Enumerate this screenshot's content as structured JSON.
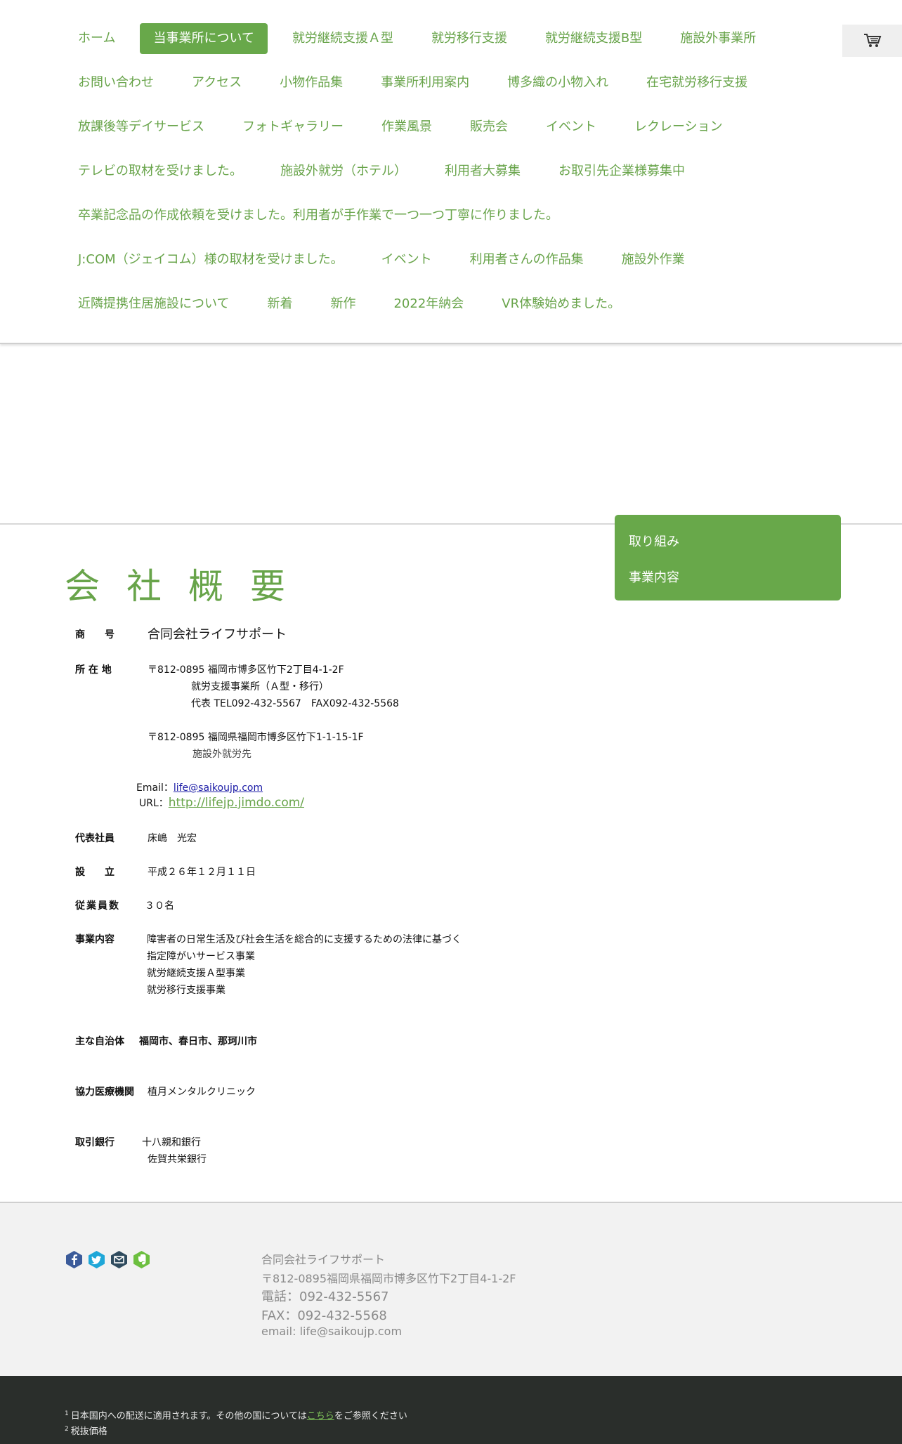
{
  "nav": {
    "rows": [
      [
        "ホーム",
        "当事業所について",
        "就労継続支援Ａ型",
        "就労移行支援",
        "就労継続支援B型",
        "施設外事業所"
      ],
      [
        "お問い合わせ",
        "アクセス",
        "小物作品集",
        "事業所利用案内",
        "博多織の小物入れ",
        "在宅就労移行支援"
      ],
      [
        "放課後等デイサービス",
        "フォトギャラリー",
        "作業風景",
        "販売会",
        "イベント",
        "レクレーション"
      ],
      [
        "テレビの取材を受けました。",
        "施設外就労（ホテル）",
        "利用者大募集",
        "お取引先企業様募集中"
      ],
      [
        "卒業記念品の作成依頼を受けました。利用者が手作業で一つ一つ丁寧に作りました。"
      ],
      [
        "J:COM（ジェイコム）様の取材を受けました。",
        "イベント",
        "利用者さんの作品集",
        "施設外作業"
      ],
      [
        "近隣提携住居施設について",
        "新着",
        "新作",
        "2022年納会",
        "VR体験始めました。"
      ]
    ],
    "active": "当事業所について",
    "cart_icon": "cart-icon"
  },
  "submenu": {
    "items": [
      "取り組み",
      "事業内容"
    ]
  },
  "company": {
    "title": "会社概要",
    "name_label": "商　　号",
    "name_value": "合同会社ライフサポート",
    "address_label": "所 在 地",
    "address_lines": [
      "〒812-0895 福岡市博多区竹下2丁目4-1-2F",
      "就労支援事業所（Ａ型・移行）",
      "代表 TEL092-432-5567　FAX092-432-5568"
    ],
    "address2_lines": [
      "〒812-0895 福岡県福岡市博多区竹下1-1-15-1F",
      "施設外就労先"
    ],
    "email_label": "Email：",
    "email": "life@saikoujp.com",
    "url_label": "URL：",
    "url": "http://lifejp.jimdo.com/",
    "rep_label": "代表社員",
    "rep_value": "床嶋　光宏",
    "est_label": "設　　立",
    "est_value": "平成２６年１２月１１日",
    "emp_label": "従業員数",
    "emp_value": "３０名",
    "biz_label": "事業内容",
    "biz_lines": [
      "障害者の日常生活及び社会生活を総合的に支援するための法律に基づく",
      "指定障がいサービス事業",
      "就労継続支援Ａ型事業",
      "就労移行支援事業"
    ],
    "muni_label": "主な自治体",
    "muni_value": "福岡市、春日市、那珂川市",
    "med_label": "協力医療機関",
    "med_value": "植月メンタルクリニック",
    "bank_label": "取引銀行",
    "bank_lines": [
      "十八親和銀行",
      "佐賀共栄銀行"
    ]
  },
  "footer": {
    "social": [
      "facebook-icon",
      "twitter-icon",
      "email-icon",
      "evernote-icon"
    ],
    "company": "合同会社ライフサポート",
    "address": "〒812-0895福岡県福岡市博多区竹下2丁目4-1-2F",
    "phone": "電話：092-432-5567",
    "fax": "FAX：092-432-5568",
    "email": "email: life@saikoujp.com",
    "note1_num": "1",
    "note1_pre": "日本国内への配送に適用されます。その他の国については",
    "note1_link": "こちら",
    "note1_post": "をご参照ください",
    "note2_num": "2",
    "note2": "税抜価格"
  }
}
